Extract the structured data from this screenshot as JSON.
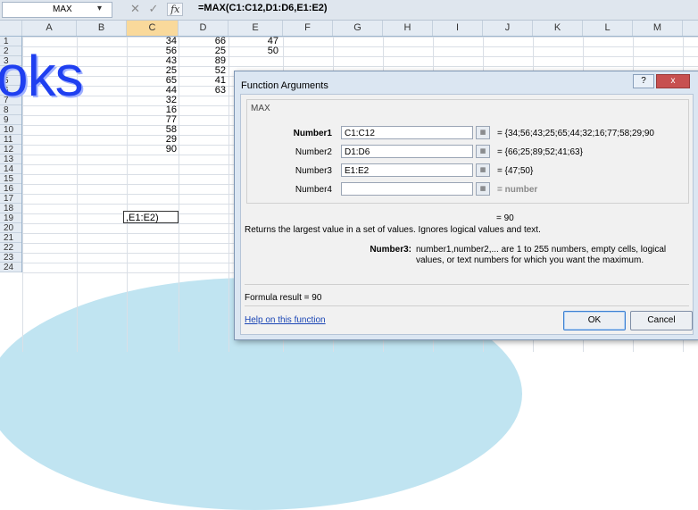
{
  "formula_bar": {
    "name_box": "MAX",
    "formula": "=MAX(C1:C12,D1:D6,E1:E2)"
  },
  "columns": [
    "A",
    "B",
    "C",
    "D",
    "E",
    "F",
    "G",
    "H",
    "I",
    "J",
    "K",
    "L",
    "M"
  ],
  "rows": [
    "1",
    "2",
    "3",
    "4",
    "5",
    "6",
    "7",
    "8",
    "9",
    "10",
    "11",
    "12",
    "13",
    "14",
    "15",
    "16",
    "17",
    "18",
    "19",
    "20",
    "21",
    "22",
    "23",
    "24"
  ],
  "cells": {
    "c": [
      "34",
      "56",
      "43",
      "25",
      "65",
      "44",
      "32",
      "16",
      "77",
      "58",
      "29",
      "90"
    ],
    "d": [
      "66",
      "25",
      "89",
      "52",
      "41",
      "63"
    ],
    "e": [
      "47",
      "50"
    ],
    "edit": ",E1:E2)"
  },
  "watermark": "oks",
  "dialog": {
    "title": "Function Arguments",
    "help_btn": "?",
    "close_btn": "x",
    "function_name": "MAX",
    "args": [
      {
        "label": "Number1",
        "value": "C1:C12",
        "result": "=  {34;56;43;25;65;44;32;16;77;58;29;90"
      },
      {
        "label": "Number2",
        "value": "D1:D6",
        "result": "=  {66;25;89;52;41;63}"
      },
      {
        "label": "Number3",
        "value": "E1:E2",
        "result": "=  {47;50}"
      },
      {
        "label": "Number4",
        "value": "",
        "result": "=  number"
      }
    ],
    "overall_result": "=  90",
    "description": "Returns the largest value in a set of values. Ignores logical values and text.",
    "arg_help_label": "Number3:",
    "arg_help_text": "number1,number2,... are 1 to 255 numbers, empty cells, logical values, or text numbers for which you want the maximum.",
    "formula_result": "Formula result =   90",
    "help_link": "Help on this function",
    "ok": "OK",
    "cancel": "Cancel"
  }
}
